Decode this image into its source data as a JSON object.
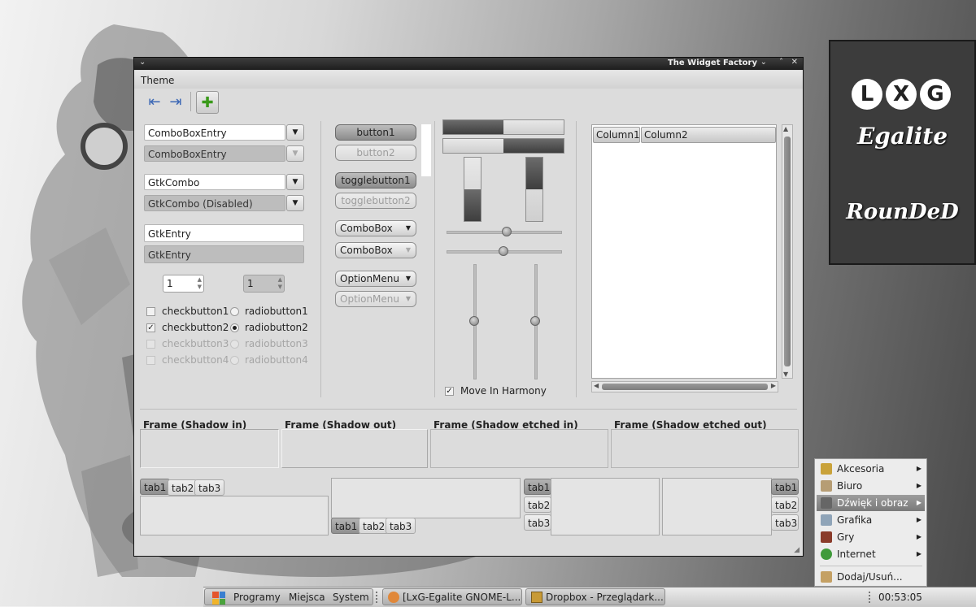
{
  "desktop": {
    "logo_letters": [
      "L",
      "X",
      "G"
    ],
    "logo_title": "Egalite",
    "logo_subtitle": "RounDeD"
  },
  "window": {
    "title": "The Widget Factory",
    "menu": "Theme",
    "left": {
      "combos": [
        "ComboBoxEntry",
        "ComboBoxEntry",
        "GtkCombo",
        "GtkCombo (Disabled)"
      ],
      "entries": [
        "GtkEntry",
        "GtkEntry"
      ],
      "spin_values": [
        "1",
        "1"
      ],
      "checks": [
        "checkbutton1",
        "checkbutton2",
        "checkbutton3",
        "checkbutton4"
      ],
      "radios": [
        "radiobutton1",
        "radiobutton2",
        "radiobutton3",
        "radiobutton4"
      ]
    },
    "buttons": {
      "button1": "button1",
      "button2": "button2",
      "toggle1": "togglebutton1",
      "toggle2": "togglebutton2",
      "combo1": "ComboBox",
      "combo2": "ComboBox",
      "option1": "OptionMenu",
      "option2": "OptionMenu"
    },
    "ranges": {
      "hprogress": [
        0.5,
        0.5
      ],
      "vprogress": [
        0.5,
        0.5
      ],
      "hscale": [
        0.5,
        0.5
      ],
      "vscale": [
        0.5,
        0.5
      ],
      "harmony_label": "Move In Harmony"
    },
    "tree": {
      "columns": [
        "Column1",
        "Column2"
      ]
    },
    "frames": [
      "Frame (Shadow in)",
      "Frame (Shadow out)",
      "Frame (Shadow etched in)",
      "Frame (Shadow etched out)"
    ],
    "tabs": [
      "tab1",
      "tab2",
      "tab3"
    ]
  },
  "taskbar": {
    "programs": "Programy",
    "places": "Miejsca",
    "system": "System",
    "task1": "[LxG-Egalite GNOME-L...",
    "task2": "Dropbox - Przeglądark...",
    "clock": "00:53:05"
  },
  "app_menu": {
    "items": [
      "Akcesoria",
      "Biuro",
      "Dźwięk i obraz",
      "Grafika",
      "Gry",
      "Internet",
      "Dodaj/Usuń..."
    ]
  }
}
